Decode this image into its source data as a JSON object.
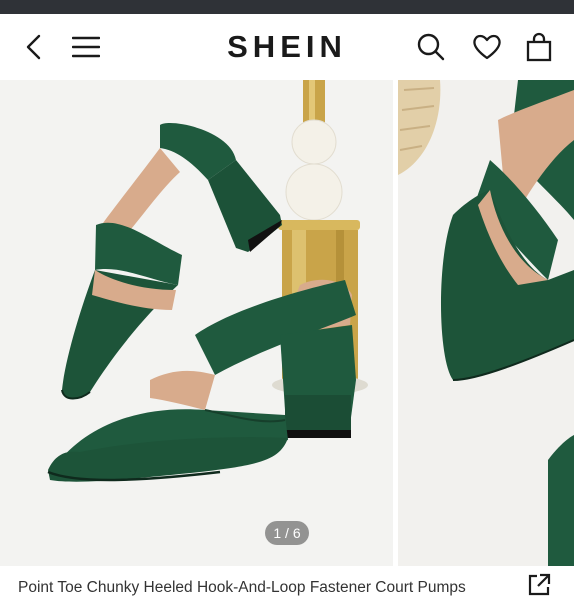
{
  "header": {
    "brand": "SHEIN",
    "icons": [
      "back-icon",
      "menu-icon",
      "search-icon",
      "heart-icon",
      "bag-icon"
    ]
  },
  "gallery": {
    "page_indicator": "1 / 6",
    "images": [
      "green-suede-pumps-pair",
      "green-suede-pump-closeup"
    ]
  },
  "product": {
    "title": "Point Toe Chunky Heeled Hook-And-Loop Fastener Court Pumps"
  },
  "colors": {
    "shoe_green": "#1f5a3e",
    "background": "#f3f3f1",
    "gold": "#c9a449",
    "status_bar": "#2f3237"
  }
}
